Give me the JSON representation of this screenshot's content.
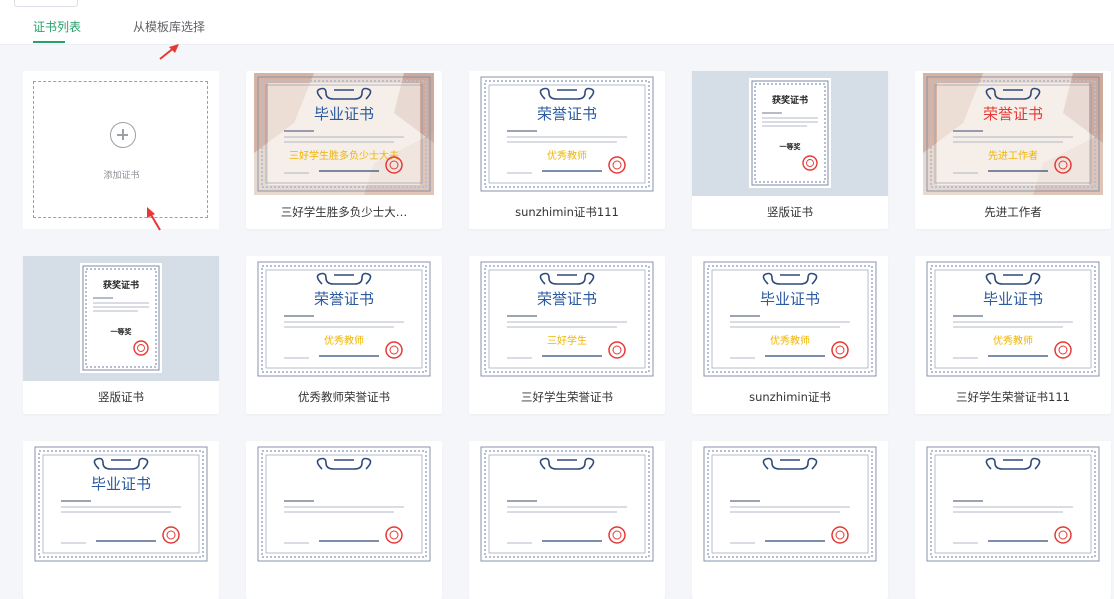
{
  "tabs": [
    {
      "label": "证书列表",
      "active": true
    },
    {
      "label": "从模板库选择",
      "active": false
    }
  ],
  "add_card": {
    "label": "添加证书"
  },
  "accent_color": "#25a16b",
  "certificates": [
    {
      "name": "三好学生胜多负少士大…",
      "title": "毕业证书",
      "style": "photo",
      "subtitle": "三好学生胜多负少士大夫"
    },
    {
      "name": "sunzhimin证书111",
      "title": "荣誉证书",
      "style": "landscape",
      "subtitle": "优秀教师"
    },
    {
      "name": "竖版证书",
      "title": "获奖证书",
      "style": "portrait",
      "subtitle": "一等奖"
    },
    {
      "name": "先进工作者",
      "title": "荣誉证书",
      "style": "photo",
      "subtitle": "先进工作者"
    },
    {
      "name": "竖版证书",
      "title": "获奖证书",
      "style": "portrait",
      "subtitle": "一等奖"
    },
    {
      "name": "优秀教师荣誉证书",
      "title": "荣誉证书",
      "style": "landscape",
      "subtitle": "优秀教师"
    },
    {
      "name": "三好学生荣誉证书",
      "title": "荣誉证书",
      "style": "landscape",
      "subtitle": "三好学生"
    },
    {
      "name": "sunzhimin证书",
      "title": "毕业证书",
      "style": "landscape",
      "subtitle": "优秀教师"
    },
    {
      "name": "三好学生荣誉证书111",
      "title": "毕业证书",
      "style": "landscape",
      "subtitle": "优秀教师"
    },
    {
      "name": "",
      "title": "毕业证书",
      "style": "landscape",
      "subtitle": ""
    },
    {
      "name": "",
      "title": "",
      "style": "landscape",
      "subtitle": ""
    },
    {
      "name": "",
      "title": "",
      "style": "landscape",
      "subtitle": ""
    },
    {
      "name": "",
      "title": "",
      "style": "landscape",
      "subtitle": ""
    },
    {
      "name": "",
      "title": "",
      "style": "landscape",
      "subtitle": ""
    }
  ]
}
